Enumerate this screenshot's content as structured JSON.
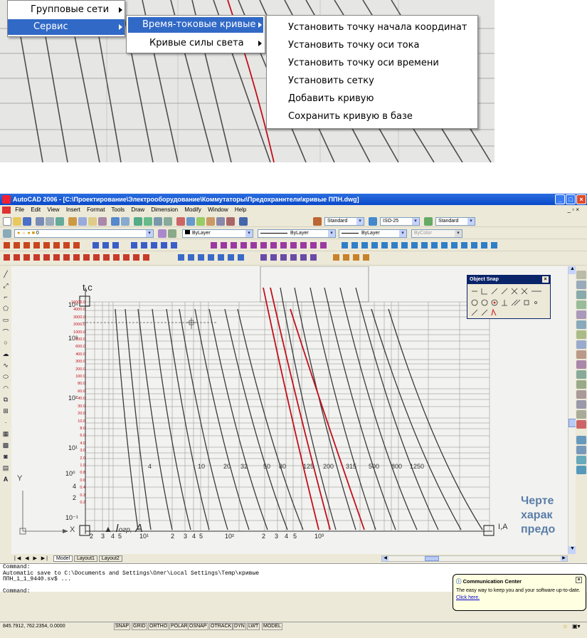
{
  "context_menu": {
    "level1": [
      {
        "label": "Групповые сети",
        "selected": false
      },
      {
        "label": "Сервис",
        "selected": true
      }
    ],
    "level2": [
      {
        "label": "Время-токовые кривые",
        "selected": true
      },
      {
        "label": "Кривые силы света",
        "selected": false
      }
    ],
    "level3": [
      "Установить точку начала координат",
      "Установить точку оси тока",
      "Установить точку оси времени",
      "Установить сетку",
      "Добавить кривую",
      "Сохранить кривую в базе"
    ]
  },
  "app": {
    "title": "AutoCAD 2006 - [C:\\Проектирование\\Электрооборудование\\Коммутаторы\\Предохраннтели\\кривые ППН.dwg]",
    "menu": [
      "File",
      "Edit",
      "View",
      "Insert",
      "Format",
      "Tools",
      "Draw",
      "Dimension",
      "Modify",
      "Window",
      "Help"
    ],
    "text_style": "Standard",
    "dim_style": "ISO-25",
    "table_style": "Standard",
    "layer": "0",
    "color": "ByLayer",
    "linetype": "ByLayer",
    "lineweight": "ByLayer",
    "plotstyle": "ByColor"
  },
  "drawing": {
    "y_label": "t,c",
    "x_label": "I",
    "x_sub": "огр,",
    "x_unit": "A",
    "ia_label": "I,A",
    "ucs_x": "X",
    "ucs_y": "Y",
    "time_ticks_red": [
      "10000.0",
      "4000.0",
      "3000.0",
      "2000.0",
      "1000.0",
      "800.0",
      "600.0",
      "400.0",
      "300.0",
      "200.0",
      "100.0",
      "80.0",
      "60.0",
      "40.0",
      "30.0",
      "20.0",
      "10.0",
      "8.0",
      "6.0",
      "4.0",
      "3.0",
      "2.0",
      "1.0",
      "0.8",
      "0.6",
      "0.4",
      "0.3",
      "0.2"
    ],
    "time_ticks_black": [
      "10⁴",
      "10³",
      "10²",
      "10¹",
      "10⁰",
      "10⁻¹",
      "4",
      "2"
    ],
    "current_ticks_black": [
      "2",
      "3",
      "4",
      "5",
      "10¹",
      "2",
      "3",
      "4",
      "5",
      "10²",
      "2",
      "3",
      "4",
      "5",
      "10³"
    ],
    "curve_ratings": [
      "4",
      "10",
      "20",
      "32",
      "50",
      "80",
      "125",
      "200",
      "315",
      "500",
      "800",
      "1250"
    ],
    "side_text": [
      "Черте",
      "харак",
      "предо"
    ]
  },
  "object_snap": {
    "title": "Object Snap"
  },
  "layout_tabs": [
    "Model",
    "Layout1",
    "Layout2"
  ],
  "command_lines": [
    "Command:",
    "Automatic save to C:\\Documents and Settings\\Олег\\Local Settings\\Temp\\кривые",
    "ППН_1_1_9440.sv$ ...",
    "",
    "Command:"
  ],
  "status": {
    "coords": "845.7912, 762.2354, 0.0000",
    "toggles": [
      "SNAP",
      "GRID",
      "ORTHO",
      "POLAR",
      "OSNAP",
      "OTRACK",
      "DYN",
      "LWT",
      "MODEL"
    ]
  },
  "comm_center": {
    "title": "Communication Center",
    "body": "The easy way to keep you and your software up-to-date.",
    "link": "Click here."
  },
  "colors": {
    "title_blue": "#0a49c9",
    "menu_select": "#3169c6",
    "curve_red": "#c0101a"
  }
}
